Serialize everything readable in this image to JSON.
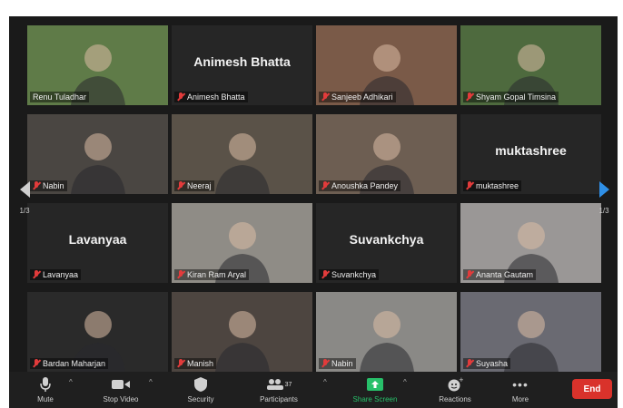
{
  "participants": [
    {
      "name": "Renu Tuladhar",
      "big_name": "",
      "bg": "#5f7b48"
    },
    {
      "name": "Animesh Bhatta",
      "big_name": "Animesh Bhatta",
      "bg": "#262626"
    },
    {
      "name": "Sanjeeb Adhikari",
      "big_name": "",
      "bg": "#7a5a48"
    },
    {
      "name": "Shyam Gopal Timsina",
      "big_name": "",
      "bg": "#4e6a3e"
    },
    {
      "name": "Nabin",
      "big_name": "",
      "bg": "#4a4642"
    },
    {
      "name": "Neeraj",
      "big_name": "",
      "bg": "#5a5248"
    },
    {
      "name": "Anoushka Pandey",
      "big_name": "",
      "bg": "#6d5e52"
    },
    {
      "name": "muktashree",
      "big_name": "muktashree",
      "bg": "#262626"
    },
    {
      "name": "Lavanyaa",
      "big_name": "Lavanyaa",
      "bg": "#262626"
    },
    {
      "name": "Kiran Ram Aryal",
      "big_name": "",
      "bg": "#8f8c86"
    },
    {
      "name": "Suvankchya",
      "big_name": "Suvankchya",
      "bg": "#262626"
    },
    {
      "name": "Ananta Gautam",
      "big_name": "",
      "bg": "#9a9796"
    },
    {
      "name": "Bardan Maharjan",
      "big_name": "",
      "bg": "#2a2a2a"
    },
    {
      "name": "Manish",
      "big_name": "",
      "bg": "#4d4540"
    },
    {
      "name": "Nabin",
      "big_name": "",
      "bg": "#8a8986"
    },
    {
      "name": "Suyasha",
      "big_name": "",
      "bg": "#6a6a72"
    }
  ],
  "pagination": {
    "left": "1/3",
    "right": "1/3"
  },
  "toolbar": {
    "mute": "Mute",
    "stop_video": "Stop Video",
    "security": "Security",
    "participants": "Participants",
    "participant_count": "37",
    "share_screen": "Share Screen",
    "reactions": "Reactions",
    "more": "More",
    "end": "End"
  },
  "colors": {
    "background": "#1a1a1a",
    "tile": "#262626",
    "active_speaker_border": "#c6e03a",
    "end_button": "#d9322b",
    "share_green": "#27c06a",
    "next_arrow": "#2f8fe6",
    "mic_muted": "#e23b3b"
  }
}
